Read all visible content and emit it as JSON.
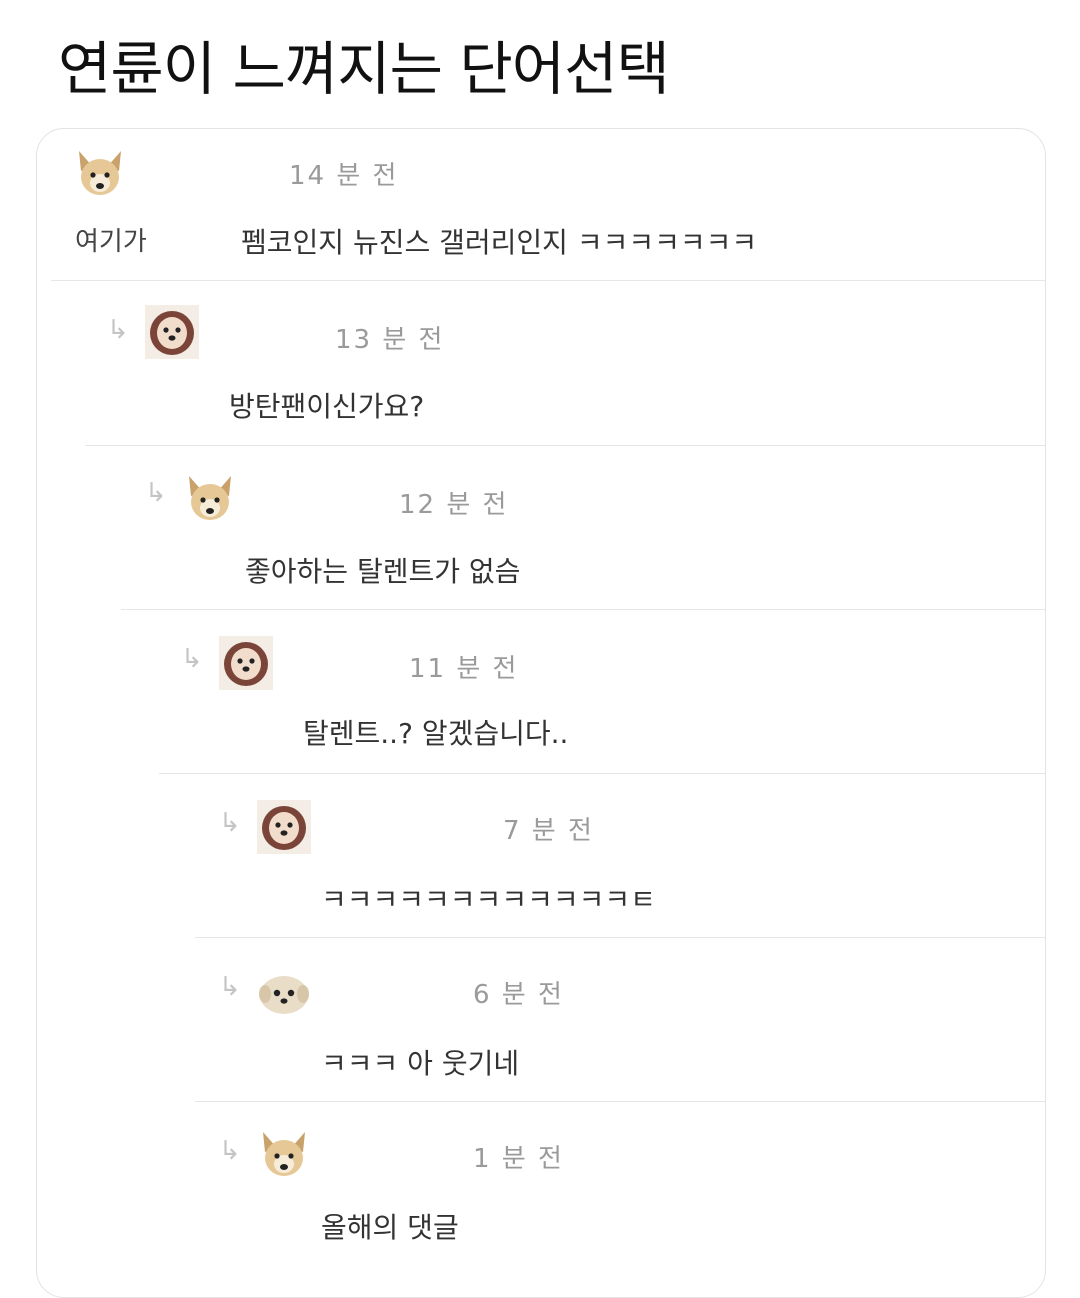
{
  "title": "연륜이 느껴지는 단어선택",
  "comments": [
    {
      "author": "여기가",
      "time": "14 분 전",
      "text": "펨코인지 뉴진스 갤러리인지 ㅋㅋㅋㅋㅋㅋㅋ",
      "avatar": "dog-avatar"
    },
    {
      "author": "",
      "time": "13 분 전",
      "text": "방탄팬이신가요?",
      "avatar": "fluffy-dog-avatar"
    },
    {
      "author": "",
      "time": "12 분 전",
      "text": "좋아하는 탈렌트가 없슴",
      "avatar": "dog-avatar"
    },
    {
      "author": "",
      "time": "11 분 전",
      "text": "탈렌트..? 알겠습니다..",
      "avatar": "fluffy-dog-avatar"
    },
    {
      "author": "",
      "time": "7 분 전",
      "text": "ㅋㅋㅋㅋㅋㅋㅋㅋㅋㅋㅋㅋㅌ",
      "avatar": "fluffy-dog-avatar"
    },
    {
      "author": "",
      "time": "6 분 전",
      "text": "ㅋㅋㅋ 아 웃기네",
      "avatar": "puppy-avatar"
    },
    {
      "author": "",
      "time": "1 분 전",
      "text": "올해의 댓글",
      "avatar": "dog-avatar"
    }
  ],
  "colors": {
    "time": "#9a9a9a",
    "separator": "#e6e6e6",
    "arrow": "#c4c4c4"
  }
}
